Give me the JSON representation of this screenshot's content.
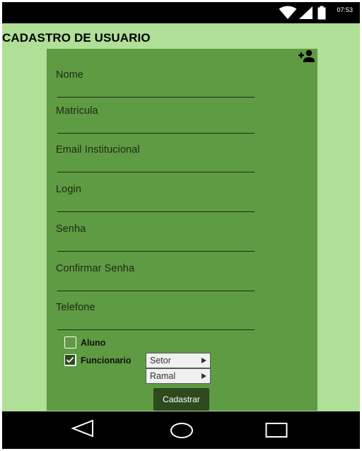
{
  "status_bar": {
    "time": "07:53",
    "icons": [
      "wifi-icon",
      "signal-icon",
      "battery-icon"
    ]
  },
  "page": {
    "title": "CADASTRO DE USUARIO"
  },
  "form": {
    "fields": [
      {
        "label": "Nome"
      },
      {
        "label": "Matricula"
      },
      {
        "label": "Email Institucional"
      },
      {
        "label": "Login"
      },
      {
        "label": "Senha"
      },
      {
        "label": "Confirmar Senha"
      },
      {
        "label": "Telefone"
      }
    ],
    "checkboxes": [
      {
        "label": "Aluno",
        "checked": false
      },
      {
        "label": "Funcionario",
        "checked": true
      }
    ],
    "menu_items": [
      {
        "label": "Setor"
      },
      {
        "label": "Ramal"
      }
    ],
    "submit_label": "Cadastrar",
    "header_icon": "add-person-icon"
  },
  "nav_bar": {
    "buttons": [
      "back-icon",
      "home-icon",
      "recents-icon"
    ]
  },
  "colors": {
    "background": "#b0df97",
    "card": "#5f9b42",
    "button": "#2d4a1e",
    "bars": "#000000"
  }
}
